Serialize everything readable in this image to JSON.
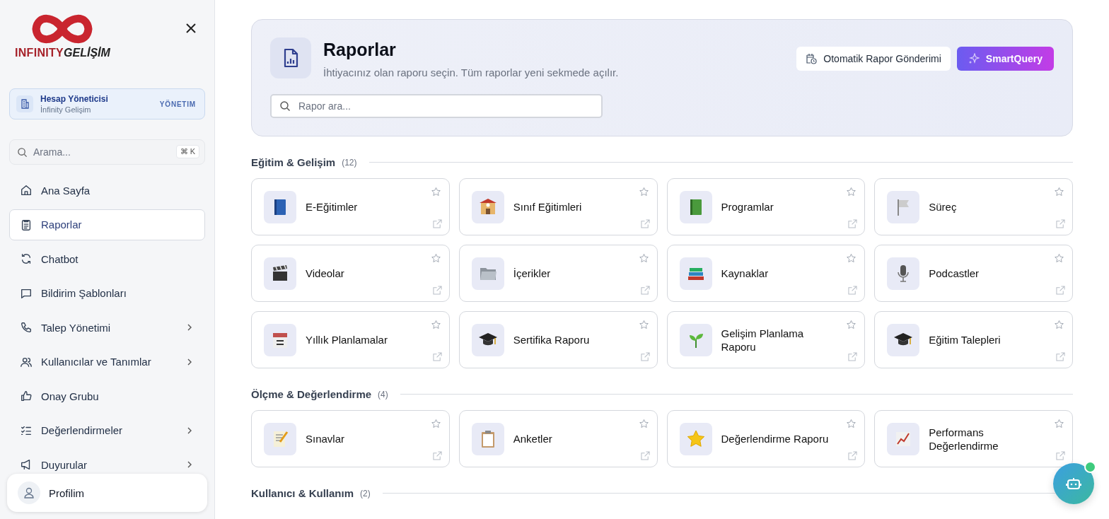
{
  "logo": {
    "word_1": "INFINITY",
    "word_2": "GELİŞİM"
  },
  "account": {
    "title": "Hesap Yöneticisi",
    "subtitle": "İnfinity Gelişim",
    "badge": "YÖNETIM"
  },
  "sidebar_search": {
    "placeholder": "Arama...",
    "shortcut_1": "⌘",
    "shortcut_2": "K"
  },
  "nav": [
    {
      "label": "Ana Sayfa",
      "selected": false,
      "submenu": false
    },
    {
      "label": "Raporlar",
      "selected": true,
      "submenu": false
    },
    {
      "label": "Chatbot",
      "selected": false,
      "submenu": false
    },
    {
      "label": "Bildirim Şablonları",
      "selected": false,
      "submenu": false
    },
    {
      "label": "Talep Yönetimi",
      "selected": false,
      "submenu": true
    },
    {
      "label": "Kullanıcılar ve Tanımlar",
      "selected": false,
      "submenu": true
    },
    {
      "label": "Onay Grubu",
      "selected": false,
      "submenu": false
    },
    {
      "label": "Değerlendirmeler",
      "selected": false,
      "submenu": true
    },
    {
      "label": "Duyurular",
      "selected": false,
      "submenu": true
    }
  ],
  "profile": {
    "label": "Profilim"
  },
  "header": {
    "title": "Raporlar",
    "subtitle": "İhtiyacınız olan raporu seçin. Tüm raporlar yeni sekmede açılır.",
    "search_placeholder": "Rapor ara...",
    "buttons": [
      {
        "label": "Otomatik Rapor Gönderimi",
        "kind": "plain"
      },
      {
        "label": "SmartQuery",
        "kind": "primary"
      }
    ]
  },
  "sections": [
    {
      "title": "Eğitim & Gelişim",
      "count": "(12)",
      "reports": [
        {
          "label": "E-Eğitimler"
        },
        {
          "label": "Sınıf Eğitimleri"
        },
        {
          "label": "Programlar"
        },
        {
          "label": "Süreç"
        },
        {
          "label": "Videolar"
        },
        {
          "label": "İçerikler"
        },
        {
          "label": "Kaynaklar"
        },
        {
          "label": "Podcastler"
        },
        {
          "label": "Yıllık Planlamalar"
        },
        {
          "label": "Sertifika Raporu"
        },
        {
          "label": "Gelişim Planlama Raporu"
        },
        {
          "label": "Eğitim Talepleri"
        }
      ]
    },
    {
      "title": "Ölçme & Değerlendirme",
      "count": "(4)",
      "reports": [
        {
          "label": "Sınavlar"
        },
        {
          "label": "Anketler"
        },
        {
          "label": "Değerlendirme Raporu"
        },
        {
          "label": "Performans Değerlendirme"
        }
      ]
    },
    {
      "title": "Kullanıcı & Kullanım",
      "count": "(2)"
    }
  ]
}
